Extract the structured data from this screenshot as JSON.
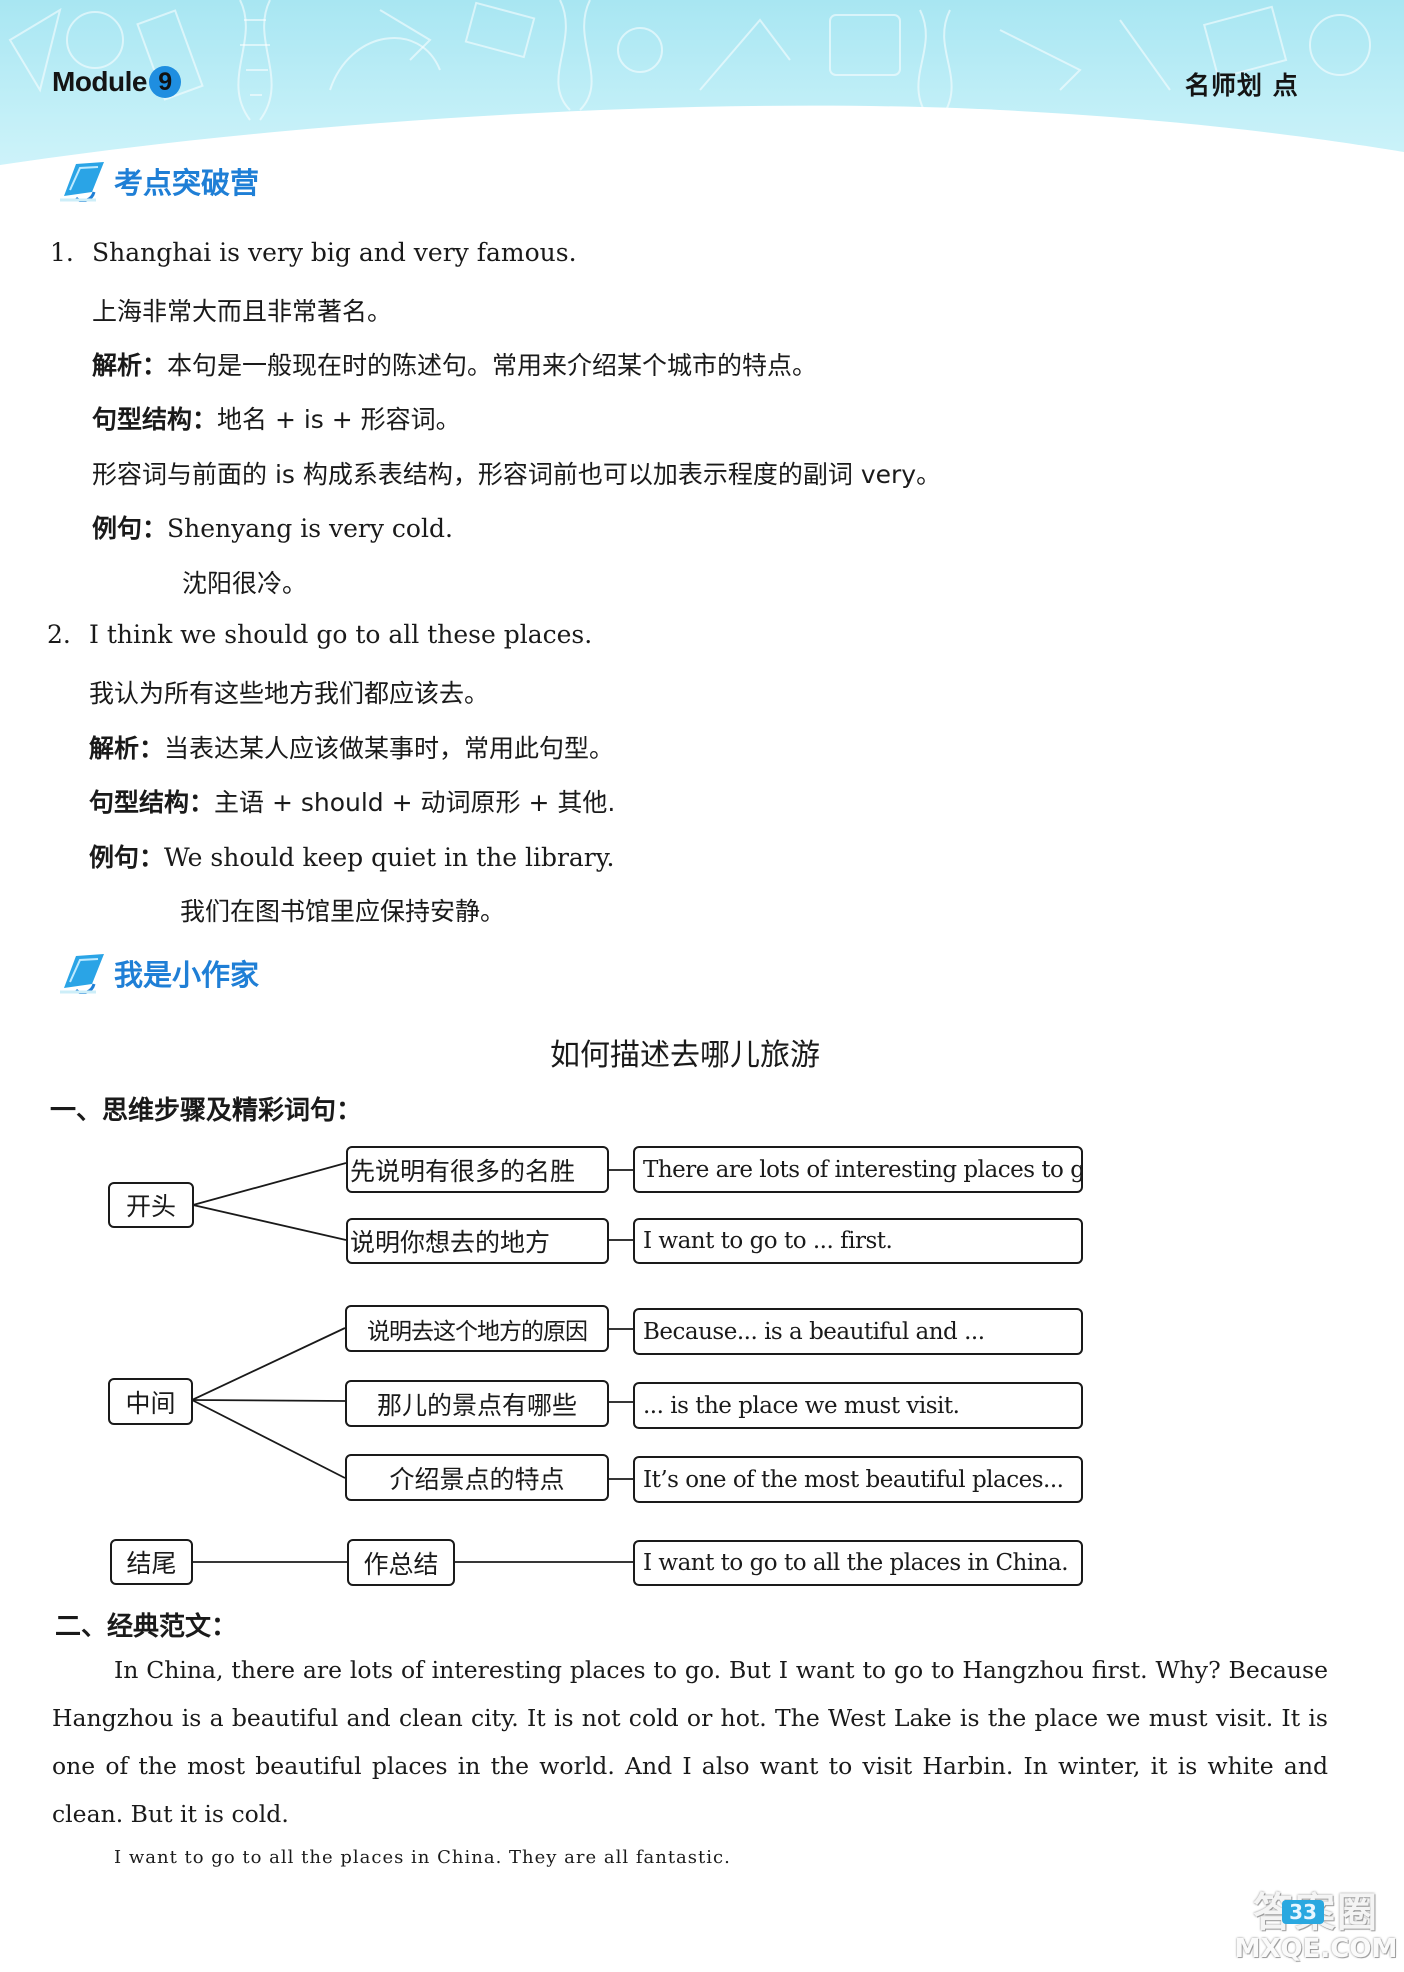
{
  "header": {
    "module_label": "Module",
    "module_number": "9",
    "brand_text": "名师划 点"
  },
  "section1": {
    "title": "考点突破营",
    "items": [
      {
        "number": "1.",
        "sentence": "Shanghai is very big and very famous.",
        "translation": "上海非常大而且非常著名。",
        "analysis_label": "解析：",
        "analysis": "本句是一般现在时的陈述句。常用来介绍某个城市的特点。",
        "structure_label": "句型结构：",
        "structure": "地名 + is + 形容词。",
        "note": "形容词与前面的 is 构成系表结构，形容词前也可以加表示程度的副词 very。",
        "example_label": "例句：",
        "example": "Shenyang is very cold.",
        "example_translation": "沈阳很冷。"
      },
      {
        "number": "2.",
        "sentence": "I think we should go to all these places.",
        "translation": "我认为所有这些地方我们都应该去。",
        "analysis_label": "解析：",
        "analysis": "当表达某人应该做某事时，常用此句型。",
        "structure_label": "句型结构：",
        "structure": "主语 + should + 动词原形 + 其他.",
        "example_label": "例句：",
        "example": "We should keep quiet in the library.",
        "example_translation": "我们在图书馆里应保持安静。"
      }
    ]
  },
  "section2": {
    "title": "我是小作家",
    "topic_title": "如何描述去哪儿旅游",
    "part1_title": "一、思维步骤及精彩词句：",
    "mindmap": {
      "groups": [
        {
          "label": "开头",
          "branches": [
            {
              "step": "先说明有很多的名胜",
              "phrase": "There are lots of interesting places to go."
            },
            {
              "step": "说明你想去的地方",
              "phrase": "I want to go to ... first."
            }
          ]
        },
        {
          "label": "中间",
          "branches": [
            {
              "step": "说明去这个地方的原因",
              "phrase": "Because... is a beautiful and ..."
            },
            {
              "step": "那儿的景点有哪些",
              "phrase": "... is the place we must visit."
            },
            {
              "step": "介绍景点的特点",
              "phrase": "It’s one of the most beautiful places..."
            }
          ]
        },
        {
          "label": "结尾",
          "branches": [
            {
              "step": "作总结",
              "phrase": "I want to go to all the places in China."
            }
          ]
        }
      ]
    },
    "part2_title": "二、经典范文：",
    "essay": {
      "paragraph1": "In China, there are lots of interesting places to go. But I want to go to Hangzhou first. Why? Because Hangzhou is a beautiful and clean city. It is not cold or hot. The West Lake is the place we must visit. It is one of the most beautiful places in the world. And I also want to visit Harbin. In winter, it is white and clean. But it is cold.",
      "paragraph2": "I want to go to all the places in China. They are all fantastic."
    }
  },
  "footer": {
    "page_number": "33",
    "watermark_top": "答案圈",
    "watermark_bottom": "MXQE.COM"
  },
  "colors": {
    "banner": "#b8ecf6",
    "section_title": "#1f7fd6",
    "module_badge": "#1f8ee0"
  }
}
